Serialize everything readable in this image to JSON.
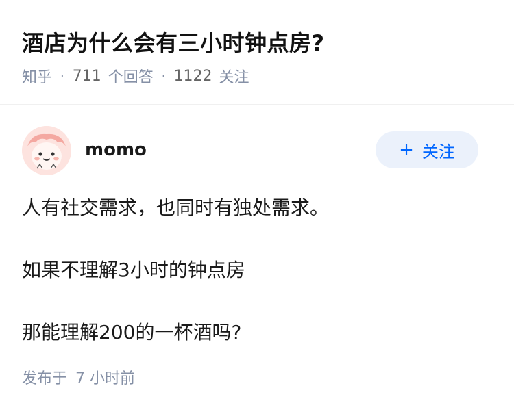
{
  "question": {
    "title": "酒店为什么会有三小时钟点房?",
    "source": "知乎",
    "answer_count": "711",
    "answer_label": "个回答",
    "follower_count": "1122",
    "follower_label": "关注"
  },
  "author": {
    "name": "momo",
    "avatar_icon": "cartoon-avatar-icon",
    "follow_plus": "+",
    "follow_label": "关注"
  },
  "answer": {
    "paragraphs": [
      "人有社交需求，也同时有独处需求。",
      "如果不理解3小时的钟点房",
      "那能理解200的一杯酒吗?"
    ]
  },
  "meta": {
    "published_label": "发布于",
    "published_time": "7 小时前"
  },
  "colors": {
    "accent": "#0066ff",
    "follow_bg": "#ebf1fb",
    "meta_text": "#8590a6",
    "title_text": "#121212"
  }
}
